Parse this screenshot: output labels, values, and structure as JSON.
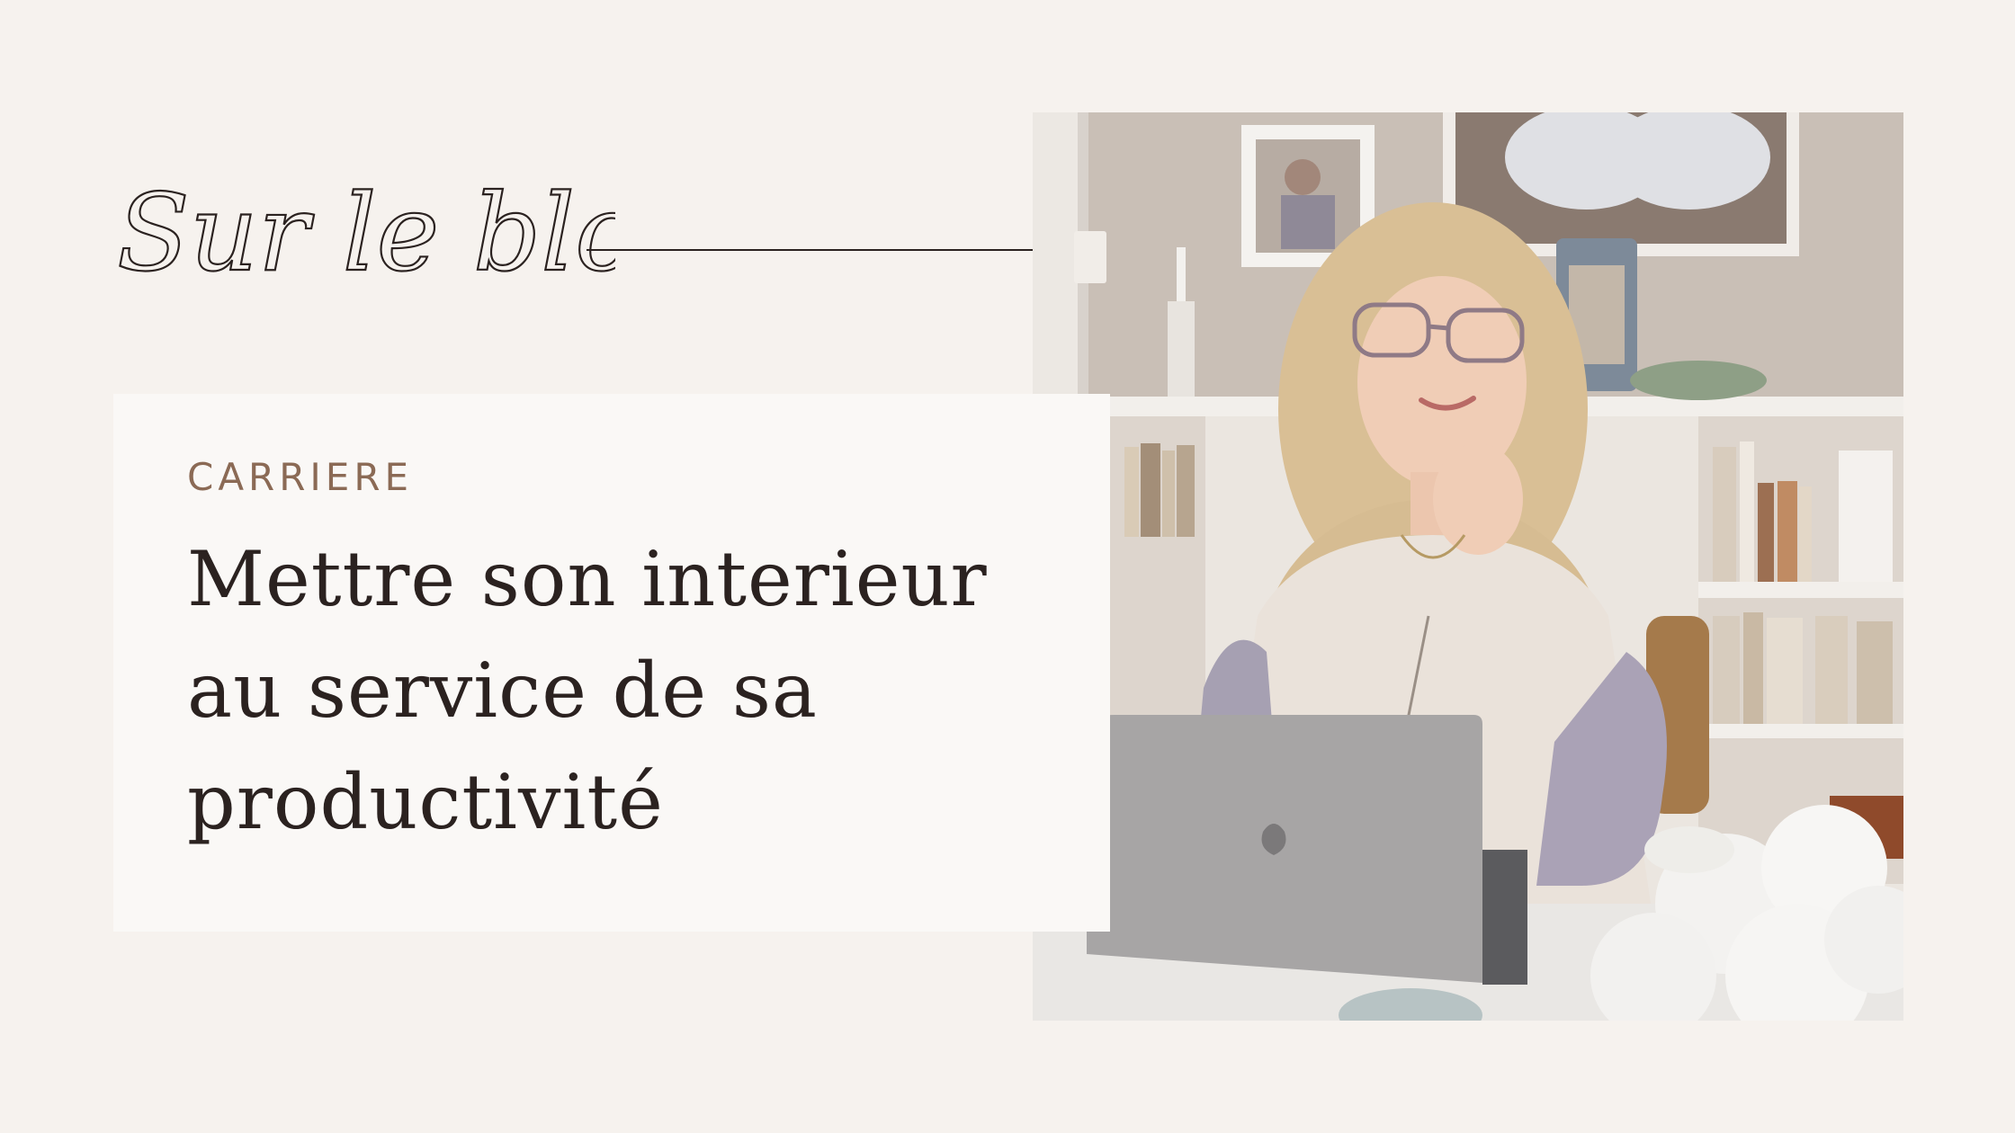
{
  "heading": {
    "script_text": "Sur le blog"
  },
  "article": {
    "category": "CARRIERE",
    "title": "Mettre son interieur au service de sa productivité"
  },
  "colors": {
    "background": "#f6f2ee",
    "card": "#faf8f6",
    "category": "#8b6a55",
    "text": "#2b2220"
  }
}
